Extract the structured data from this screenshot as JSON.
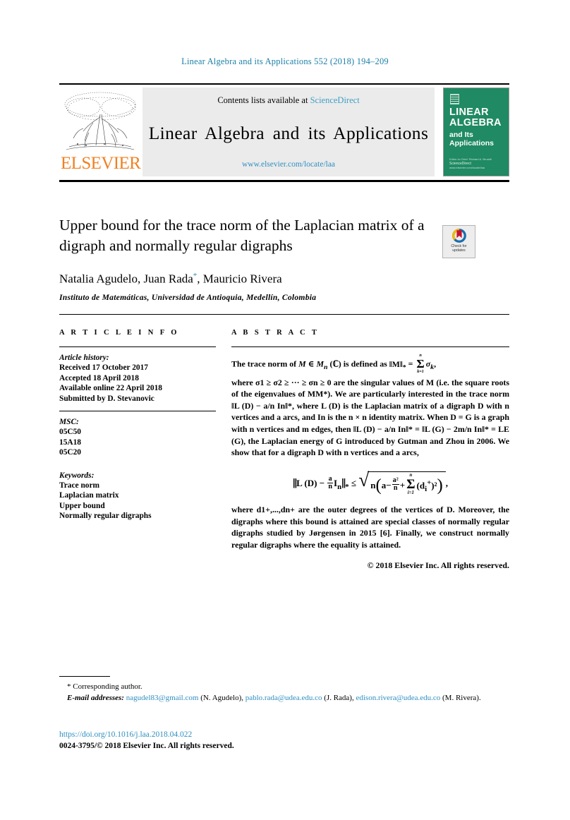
{
  "running_head": "Linear Algebra and its Applications 552 (2018) 194–209",
  "masthead": {
    "contents_prefix": "Contents lists available at ",
    "contents_link": "ScienceDirect",
    "journal_title": "Linear Algebra and its Applications",
    "journal_url": "www.elsevier.com/locate/laa",
    "publisher_wordmark": "ELSEVIER",
    "cover": {
      "line1": "LINEAR",
      "line2": "ALGEBRA",
      "line3": "and Its",
      "line4": "Applications",
      "footer_small": "Editor-in-Chief: Richard A. Brualdi",
      "footer_brand": "ScienceDirect",
      "footer_url": "www.elsevier.com/locate/laa"
    }
  },
  "article": {
    "title": "Upper bound for the trace norm of the Laplacian matrix of a digraph and normally regular digraphs",
    "authors": "Natalia Agudelo, Juan Rada",
    "authors_tail": ", Mauricio Rivera",
    "corresponding_marker": "*",
    "affiliation": "Instituto de Matemáticas, Universidad de Antioquia, Medellín, Colombia",
    "crossmark": {
      "line1": "Check for",
      "line2": "updates"
    }
  },
  "info": {
    "heading": "A R T I C L E   I N F O",
    "history_label": "Article history:",
    "history": [
      "Received 17 October 2017",
      "Accepted 18 April 2018",
      "Available online 22 April 2018",
      "Submitted by D. Stevanovic"
    ],
    "msc_label": "MSC:",
    "msc": [
      "05C50",
      "15A18",
      "05C20"
    ],
    "keywords_label": "Keywords:",
    "keywords": [
      "Trace norm",
      "Laplacian matrix",
      "Upper bound",
      "Normally regular digraphs"
    ]
  },
  "abstract": {
    "heading": "A B S T R A C T",
    "p1_a": "The trace norm of ",
    "p1_M": "M",
    "p1_b": " ∈ ",
    "p1_Mn": "M",
    "p1_n": "n",
    "p1_c": " (ℂ) is defined as ",
    "norm_M": "‖M‖",
    "star": "*",
    "eq_sum": " = ",
    "sum_upper": "n",
    "sum_lower": "k=1",
    "sigma_k": "σ",
    "sigma_k_sub": "k",
    "p1_tail": ",",
    "p2": "where σ1 ≥ σ2 ≥ ··· ≥ σn ≥ 0 are the singular values of M (i.e. the square roots of the eigenvalues of MM*). We are particularly interested in the trace norm ‖L (D) − a/n In‖*, where L (D) is the Laplacian matrix of a digraph D with n vertices and a arcs, and In is the n × n identity matrix. When D = G is a graph with n vertices and m edges, then ‖L (D) − a/n In‖* = ‖L (G) − 2m/n In‖* = LE (G), the Laplacian energy of G introduced by Gutman and Zhou in 2006. We show that for a digraph D with n vertices and a arcs,",
    "p3": "where d1+,...,dn+ are the outer degrees of the vertices of D. Moreover, the digraphs where this bound is attained are special classes of normally regular digraphs studied by Jørgensen in 2015 [6]. Finally, we construct normally regular digraphs where the equality is attained.",
    "reference_number": "6",
    "copyright": "© 2018 Elsevier Inc. All rights reserved."
  },
  "footnotes": {
    "corresponding": "* Corresponding author.",
    "email_label": "E-mail addresses:",
    "emails": [
      {
        "address": "nagudel83@gmail.com",
        "name": "(N. Agudelo),"
      },
      {
        "address": "pablo.rada@udea.edu.co",
        "name": "(J. Rada),"
      },
      {
        "address": "edison.rivera@udea.edu.co",
        "name": "(M. Rivera)."
      }
    ]
  },
  "bottom": {
    "doi": "https://doi.org/10.1016/j.laa.2018.04.022",
    "issn_copyright": "0024-3795/© 2018 Elsevier Inc. All rights reserved."
  },
  "colors": {
    "link_blue": "#2f8fc0",
    "header_blue": "#1a7fa8",
    "elsevier_orange": "#f08122",
    "cover_green": "#1f8a63"
  }
}
